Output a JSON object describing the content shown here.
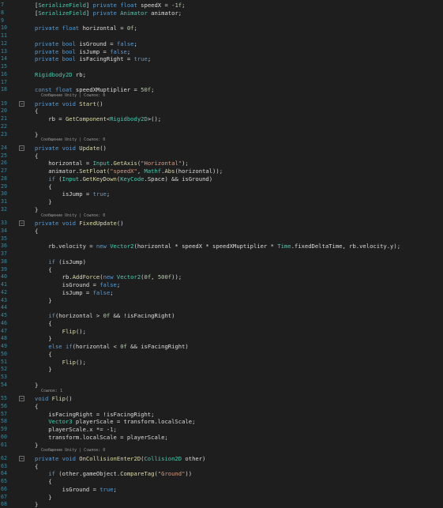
{
  "colors": {
    "background": "#1e1e1e",
    "line_number": "#2b91af",
    "keyword": "#569cd6",
    "type": "#4ec9b0",
    "method": "#dcdcaa",
    "string": "#d69d85",
    "number": "#b5cea8",
    "text": "#dcdcdc",
    "codelens": "#999999"
  },
  "lines": [
    {
      "num": "7",
      "text": "[SerializeField] private float speedX = -1f;"
    },
    {
      "num": "8",
      "text": "[SerializeField] private Animator animator;"
    },
    {
      "num": "9",
      "text": ""
    },
    {
      "num": "10",
      "text": "private float horizontal = 0f;"
    },
    {
      "num": "11",
      "text": ""
    },
    {
      "num": "12",
      "text": "private bool isGround = false;"
    },
    {
      "num": "13",
      "text": "private bool isJump = false;"
    },
    {
      "num": "14",
      "text": "private bool isFacingRight = true;"
    },
    {
      "num": "15",
      "text": ""
    },
    {
      "num": "16",
      "text": "Rigidbody2D rb;"
    },
    {
      "num": "17",
      "text": ""
    },
    {
      "num": "18",
      "text": "const float speedXMuptiplier = 50f;"
    },
    {
      "lens": "Сообщение Unity | Ссылок: 0"
    },
    {
      "num": "19",
      "text": "private void Start()"
    },
    {
      "num": "20",
      "text": "{"
    },
    {
      "num": "21",
      "text": "    rb = GetComponent<Rigidbody2D>();"
    },
    {
      "num": "22",
      "text": ""
    },
    {
      "num": "23",
      "text": "}"
    },
    {
      "lens": "Сообщение Unity | Ссылок: 0"
    },
    {
      "num": "24",
      "text": "private void Update()"
    },
    {
      "num": "25",
      "text": "{"
    },
    {
      "num": "26",
      "text": "    horizontal = Input.GetAxis(\"Horizontal\");"
    },
    {
      "num": "27",
      "text": "    animator.SetFloat(\"speedX\", Mathf.Abs(horizontal));"
    },
    {
      "num": "28",
      "text": "    if (Input.GetKeyDown(KeyCode.Space) && isGround)"
    },
    {
      "num": "29",
      "text": "    {"
    },
    {
      "num": "30",
      "text": "        isJump = true;"
    },
    {
      "num": "31",
      "text": "    }"
    },
    {
      "num": "32",
      "text": "}"
    },
    {
      "lens": "Сообщение Unity | Ссылок: 0"
    },
    {
      "num": "33",
      "text": "private void FixedUpdate()"
    },
    {
      "num": "34",
      "text": "{"
    },
    {
      "num": "35",
      "text": ""
    },
    {
      "num": "36",
      "text": "    rb.velocity = new Vector2(horizontal * speedX * speedXMuptiplier * Time.fixedDeltaTime, rb.velocity.y);"
    },
    {
      "num": "37",
      "text": ""
    },
    {
      "num": "38",
      "text": "    if (isJump)"
    },
    {
      "num": "39",
      "text": "    {"
    },
    {
      "num": "40",
      "text": "        rb.AddForce(new Vector2(0f, 500f));"
    },
    {
      "num": "41",
      "text": "        isGround = false;"
    },
    {
      "num": "42",
      "text": "        isJump = false;"
    },
    {
      "num": "43",
      "text": "    }"
    },
    {
      "num": "44",
      "text": ""
    },
    {
      "num": "45",
      "text": "    if(horizontal > 0f && !isFacingRight)"
    },
    {
      "num": "46",
      "text": "    {"
    },
    {
      "num": "47",
      "text": "        Flip();"
    },
    {
      "num": "48",
      "text": "    }"
    },
    {
      "num": "49",
      "text": "    else if(horizontal < 0f && isFacingRight)"
    },
    {
      "num": "50",
      "text": "    {"
    },
    {
      "num": "51",
      "text": "        Flip();"
    },
    {
      "num": "52",
      "text": "    }"
    },
    {
      "num": "53",
      "text": ""
    },
    {
      "num": "54",
      "text": "}"
    },
    {
      "lens": "Ссылок: 1"
    },
    {
      "num": "55",
      "text": "void Flip()"
    },
    {
      "num": "56",
      "text": "{"
    },
    {
      "num": "57",
      "text": "    isFacingRight = !isFacingRight;"
    },
    {
      "num": "58",
      "text": "    Vector3 playerScale = transform.localScale;"
    },
    {
      "num": "59",
      "text": "    playerScale.x *= -1;"
    },
    {
      "num": "60",
      "text": "    transform.localScale = playerScale;"
    },
    {
      "num": "61",
      "text": "}"
    },
    {
      "lens": "Сообщение Unity | Ссылок: 0"
    },
    {
      "num": "62",
      "text": "private void OnCollisionEnter2D(Collision2D other)"
    },
    {
      "num": "63",
      "text": "{"
    },
    {
      "num": "64",
      "text": "    if (other.gameObject.CompareTag(\"Ground\"))"
    },
    {
      "num": "65",
      "text": "    {"
    },
    {
      "num": "66",
      "text": "        isGround = true;"
    },
    {
      "num": "67",
      "text": "    }"
    },
    {
      "num": "68",
      "text": "}"
    }
  ]
}
